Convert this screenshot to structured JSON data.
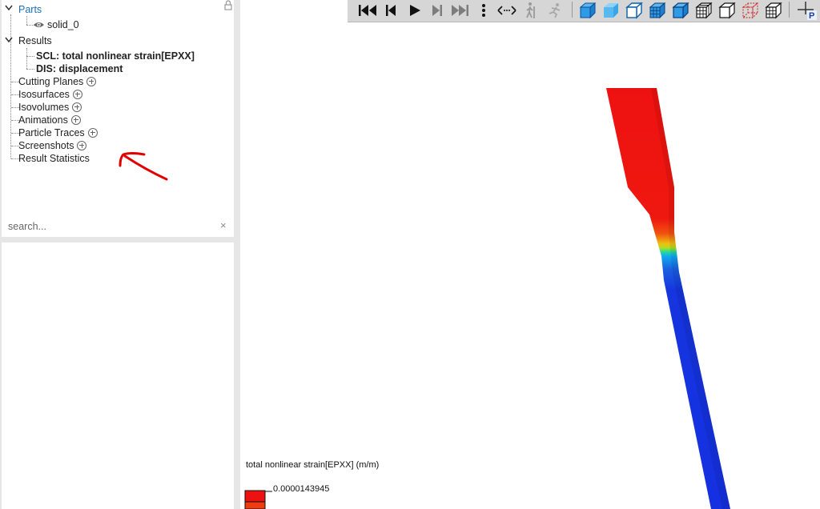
{
  "tree": {
    "parts_label": "Parts",
    "part_item": "solid_0",
    "results_label": "Results",
    "result_scl": "SCL: total nonlinear strain[EPXX]",
    "result_dis": "DIS: displacement",
    "cutting_planes": "Cutting Planes",
    "isosurfaces": "Isosurfaces",
    "isovolumes": "Isovolumes",
    "animations": "Animations",
    "particle_traces": "Particle Traces",
    "screenshots": "Screenshots",
    "result_statistics": "Result Statistics"
  },
  "search": {
    "placeholder": "search...",
    "clear": "×"
  },
  "toolbar": {
    "icons": [
      "skip-to-start-icon",
      "step-back-icon",
      "play-icon",
      "step-forward-icon",
      "skip-to-end-icon",
      "more-vertical-icon",
      "explode-icon",
      "walk-icon",
      "run-icon",
      "shaded-view-icon",
      "smooth-shaded-view-icon",
      "hidden-line-view-icon",
      "mesh-shaded-view-icon",
      "surface-outline-view-icon",
      "mesh-wireframe-view-icon",
      "wireframe-view-icon",
      "bounding-box-view-icon",
      "transparent-mesh-view-icon",
      "axis-probe-icon"
    ],
    "probe_letter": "P"
  },
  "legend": {
    "title": "total nonlinear strain[EPXX] (m/m)",
    "max_value": "0.0000143945"
  },
  "colors": {
    "tree_link": "#1a6fb5",
    "strain_high": "#ee1111",
    "strain_low": "#1530e0",
    "annotation": "#e00000"
  }
}
